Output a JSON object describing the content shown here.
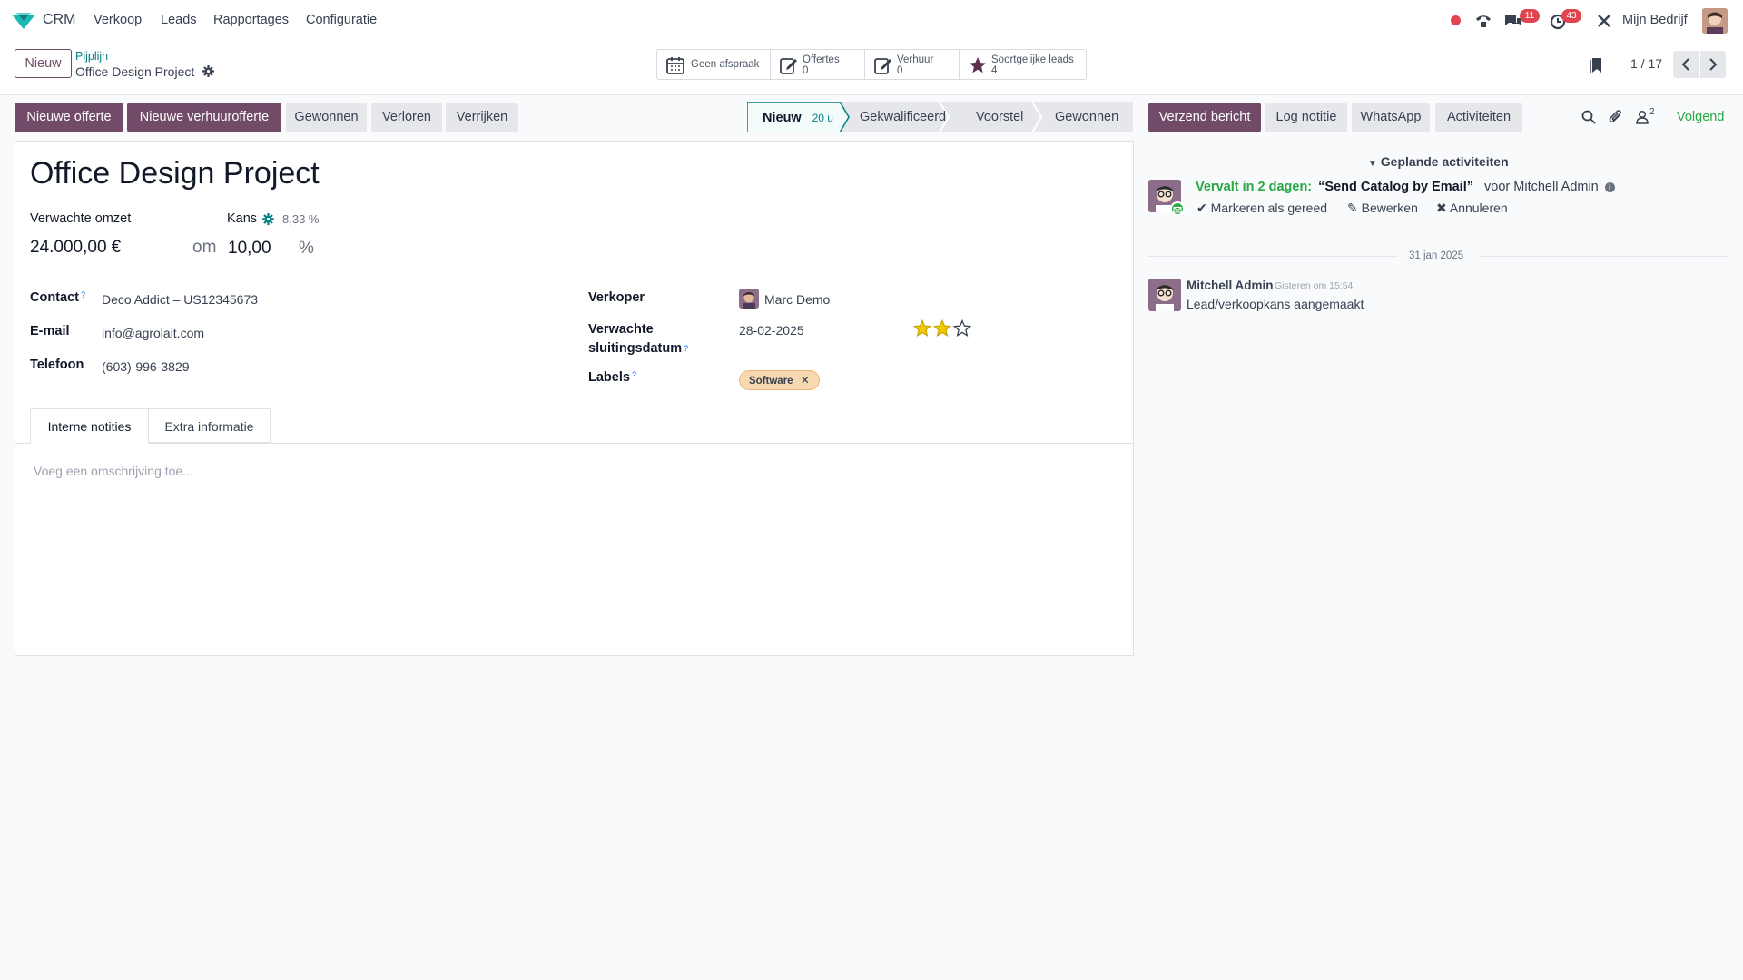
{
  "topnav": {
    "app_name": "CRM",
    "menu": [
      "Verkoop",
      "Leads",
      "Rapportages",
      "Configuratie"
    ],
    "messages_count": "11",
    "activities_count": "43",
    "company": "Mijn Bedrijf"
  },
  "control": {
    "new_button": "Nieuw",
    "breadcrumb_parent": "Pijplijn",
    "breadcrumb_current": "Office Design Project",
    "pager": "1 / 17",
    "smart_buttons": {
      "meeting": "Geen afspraak",
      "quotations_label": "Offertes",
      "quotations_value": "0",
      "rental_label": "Verhuur",
      "rental_value": "0",
      "similar_label": "Soortgelijke leads",
      "similar_value": "4"
    }
  },
  "actions": {
    "new_quotation": "Nieuwe offerte",
    "new_rental_quotation": "Nieuwe verhuurofferte",
    "won": "Gewonnen",
    "lost": "Verloren",
    "enrich": "Verrijken"
  },
  "stages": {
    "new": "Nieuw",
    "new_duration": "20 u",
    "qualified": "Gekwalificeerd",
    "proposition": "Voorstel",
    "won": "Gewonnen"
  },
  "form": {
    "title": "Office Design Project",
    "expected_revenue_label": "Verwachte omzet",
    "expected_revenue": "24.000,00 €",
    "at_label": "om",
    "probability_label": "Kans",
    "automated_probability": "8,33 %",
    "probability": "10,00",
    "percent_sign": "%",
    "contact_label": "Contact",
    "contact": "Deco Addict – US12345673",
    "email_label": "E-mail",
    "email": "info@agrolait.com",
    "phone_label": "Telefoon",
    "phone": "(603)-996-3829",
    "salesperson_label": "Verkoper",
    "salesperson": "Marc Demo",
    "closing_label_1": "Verwachte",
    "closing_label_2": "sluitingsdatum",
    "closing_date": "28-02-2025",
    "priority_stars": 2,
    "priority_max": 3,
    "tags_label": "Labels",
    "tag": "Software",
    "help_mark": "?",
    "tabs": [
      "Interne notities",
      "Extra informatie"
    ],
    "notes_placeholder": "Voeg een omschrijving toe..."
  },
  "chatter": {
    "send_message": "Verzend bericht",
    "log_note": "Log notitie",
    "whatsapp": "WhatsApp",
    "activities": "Activiteiten",
    "followers_count": "2",
    "follow": "Volgend",
    "planned_header": "Geplande activiteiten",
    "activity_due": "Vervalt in 2 dagen:",
    "activity_summary": "“Send Catalog by Email”",
    "activity_for": "voor Mitchell Admin",
    "mark_done": "Markeren als gereed",
    "edit": "Bewerken",
    "cancel": "Annuleren",
    "date_separator": "31 jan 2025",
    "message_author": "Mitchell Admin",
    "message_time": "Gisteren om 15:54",
    "message_body": "Lead/verkoopkans aangemaakt"
  },
  "colors": {
    "brand": "#714b67",
    "teal": "#017e84",
    "success": "#28a745",
    "star": "#f3cc00"
  }
}
